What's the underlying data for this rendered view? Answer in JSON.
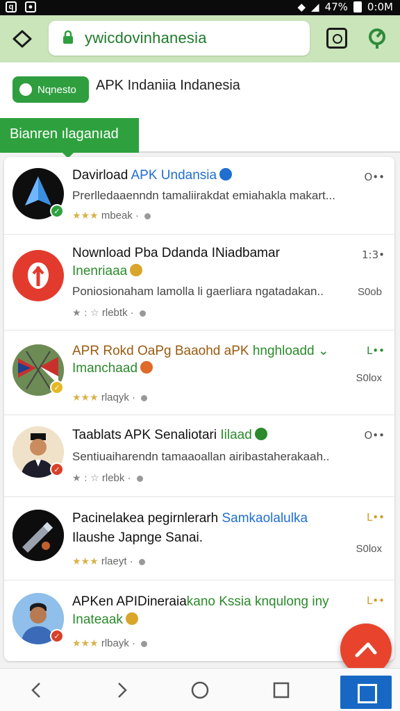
{
  "status_bar": {
    "left_icons": [
      "q-icon",
      "app-icon"
    ],
    "battery_text": "47%",
    "time": "0:0M"
  },
  "browser": {
    "url": "ywicdovinhanesia",
    "colors": {
      "bar": "#c9e5b9",
      "url_text": "#1e7a2a"
    }
  },
  "header": {
    "pill_label": "Nqnesto",
    "site_title": "APK Indaniia Indanesia",
    "section_tab": "Bianren ılaganıad"
  },
  "apps": [
    {
      "title_a": "Davirload ",
      "title_b": "APK Undansia",
      "line2": "",
      "desc": "Prerlledaaenndn tamaliirakdat emiahakla makart...",
      "meta": "mbeak ·",
      "right": "O••",
      "size": ""
    },
    {
      "title_a": "Nownload Pba Ddanda INiadbamar",
      "title_b": "",
      "line2": "Inenriaaa",
      "desc": "Poniosionaham lamolla li gaerliara ngatadakan..",
      "meta": "rlebtk ·",
      "right": "1:3•",
      "size": "S0ob"
    },
    {
      "title_a": "APR Rokd OaPg Baaohd aPK ",
      "title_b": "hnghloadd",
      "line2": "Imanchaad",
      "desc": "",
      "meta": "rlaqyk ·",
      "right": "L••",
      "size": "S0lox"
    },
    {
      "title_a": "Taablats APK Senaliotari ",
      "title_b": "Iilaad",
      "line2": "",
      "desc": "Sentiuaiharendn tamaaoallan airibastaherakaah..",
      "meta": "rlebk ·",
      "right": "O••",
      "size": ""
    },
    {
      "title_a": "Pacinelakea pegirnlerarh ",
      "title_b": "Samkaolalulka",
      "line2": "Ilaushe Japnge Sanai.",
      "desc": "",
      "meta": "rlaeyt ·",
      "right": "L••",
      "size": "S0lox"
    },
    {
      "title_a": "APKen APIDineraia",
      "title_b": "kano Kssia knqulong iny",
      "line2": "Inateaak",
      "desc": "",
      "meta": "rlbayk ·",
      "right": "L••",
      "size": ""
    }
  ],
  "icons": {
    "fab": "share-icon",
    "nav": [
      "back-icon",
      "forward-icon",
      "home-circle-icon",
      "square-icon",
      "tabs-icon"
    ]
  }
}
